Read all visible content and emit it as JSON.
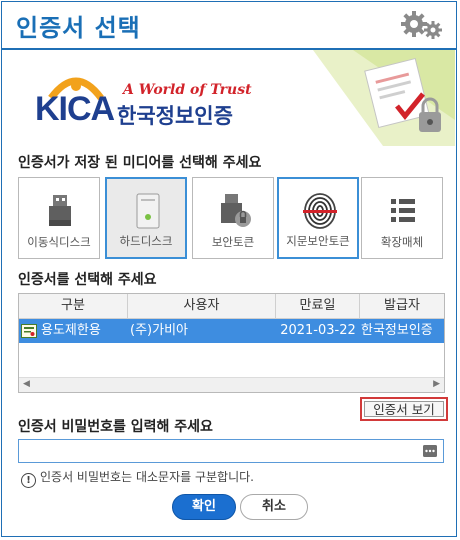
{
  "dialog": {
    "title": "인증서 선택"
  },
  "banner": {
    "tagline": "A World of Trust",
    "wordmark": "KICA",
    "org_name": "한국정보인증"
  },
  "media": {
    "heading": "인증서가 저장 된 미디어를 선택해 주세요",
    "items": [
      {
        "label": "이동식디스크",
        "icon": "usb-drive-icon",
        "state": "normal"
      },
      {
        "label": "하드디스크",
        "icon": "hard-disk-icon",
        "state": "selected"
      },
      {
        "label": "보안토큰",
        "icon": "security-token-icon",
        "state": "normal"
      },
      {
        "label": "지문보안토큰",
        "icon": "fingerprint-icon",
        "state": "focused"
      },
      {
        "label": "확장매체",
        "icon": "list-icon",
        "state": "normal"
      }
    ]
  },
  "certs": {
    "heading": "인증서를 선택해 주세요",
    "columns": [
      "구분",
      "사용자",
      "만료일",
      "발급자"
    ],
    "rows": [
      {
        "type": "용도제한용",
        "user": "(주)가비아",
        "expiry": "2021-03-22",
        "issuer": "한국정보인증"
      }
    ],
    "view_button": "인증서 보기"
  },
  "password": {
    "heading": "인증서 비밀번호를 입력해 주세요",
    "value": "",
    "hint": "인증서 비밀번호는 대소문자를 구분합니다."
  },
  "actions": {
    "ok": "확인",
    "cancel": "취소"
  },
  "colors": {
    "accent": "#1f6fb5",
    "selection": "#3e8de0",
    "highlight_border": "#d23a3a",
    "brand_red": "#d2232a",
    "brand_navy": "#1e3f8f"
  }
}
